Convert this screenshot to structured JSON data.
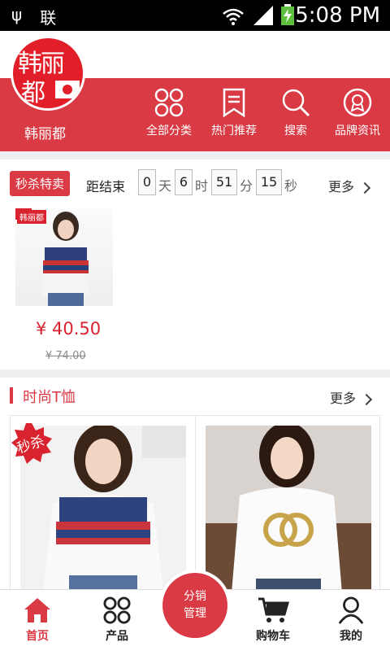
{
  "status_bar": {
    "time": "5:08 PM",
    "carrier_glyph": "联"
  },
  "brand": {
    "logo_line1": "韩丽",
    "logo_line2": "都",
    "name": "韩丽都"
  },
  "nav": [
    {
      "label": "全部分类",
      "icon": "grid-icon"
    },
    {
      "label": "热门推荐",
      "icon": "bookmark-icon"
    },
    {
      "label": "搜索",
      "icon": "search-icon"
    },
    {
      "label": "品牌资讯",
      "icon": "award-icon"
    }
  ],
  "flash_sale": {
    "badge": "秒杀特卖",
    "countdown_label": "距结束",
    "days": "0",
    "day_unit": "天",
    "hours": "6",
    "hour_unit": "时",
    "minutes": "51",
    "minute_unit": "分",
    "seconds": "15",
    "second_unit": "秒",
    "more": "更多",
    "product": {
      "price": "¥ 40.50",
      "old_price": "¥ 74.00",
      "tag": "韩丽都"
    }
  },
  "section": {
    "title": "时尚T恤",
    "more": "更多",
    "burst_label": "秒杀"
  },
  "tabbar": {
    "home": "首页",
    "products": "产品",
    "center_line1": "分销",
    "center_line2": "管理",
    "cart": "购物车",
    "mine": "我的"
  },
  "colors": {
    "brand_red": "#d93a44",
    "price_red": "#d9232e"
  }
}
